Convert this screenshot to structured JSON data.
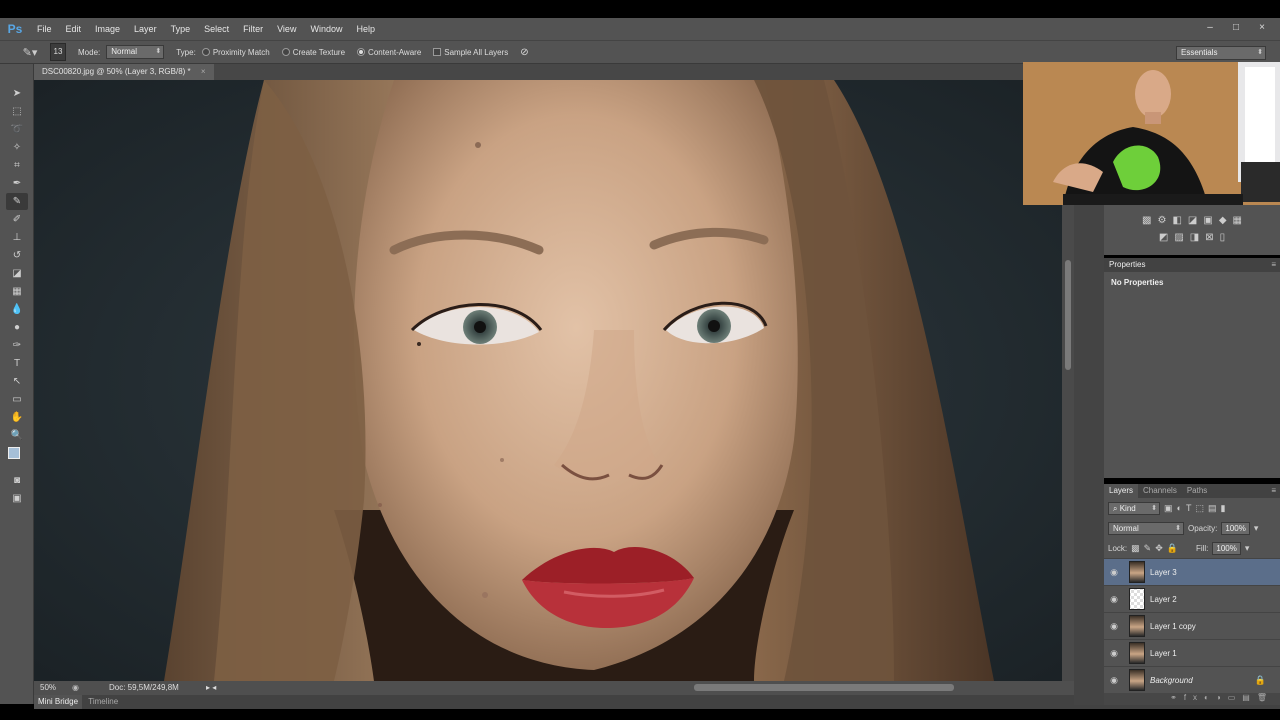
{
  "app": {
    "logo": "Ps"
  },
  "menu": [
    "File",
    "Edit",
    "Image",
    "Layer",
    "Type",
    "Select",
    "Filter",
    "View",
    "Window",
    "Help"
  ],
  "window_controls": [
    "–",
    "□",
    "×"
  ],
  "options": {
    "brush_size": "13",
    "mode_label": "Mode:",
    "mode_value": "Normal",
    "type_label": "Type:",
    "proximity_match": "Proximity Match",
    "create_texture": "Create Texture",
    "content_aware": "Content-Aware",
    "sample_all_layers": "Sample All Layers",
    "workspace": "Essentials"
  },
  "document": {
    "tab_title": "DSC00820.jpg @ 50% (Layer 3, RGB/8) *",
    "close": "×"
  },
  "status": {
    "zoom": "50%",
    "doc_size": "Doc: 59,5M/249,8M"
  },
  "bottom_tabs": [
    "Mini Bridge",
    "Timeline"
  ],
  "properties": {
    "header": "Properties",
    "content": "No Properties"
  },
  "layers": {
    "tabs": [
      "Layers",
      "Channels",
      "Paths"
    ],
    "kind_label": "Kind",
    "blend_mode": "Normal",
    "opacity_label": "Opacity:",
    "opacity": "100%",
    "lock_label": "Lock:",
    "fill_label": "Fill:",
    "fill": "100%",
    "items": [
      {
        "name": "Layer 3",
        "selected": true
      },
      {
        "name": "Layer 2"
      },
      {
        "name": "Layer 1 copy"
      },
      {
        "name": "Layer 1"
      },
      {
        "name": "Background",
        "locked": true
      }
    ]
  },
  "colors": {
    "ui_bg": "#535353",
    "selection": "#5b6e8a",
    "canvas_bg": "#232b31",
    "lips": "#b0262d"
  }
}
